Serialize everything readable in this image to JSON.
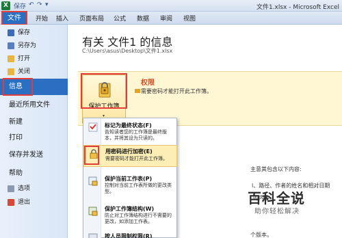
{
  "window": {
    "title": "文件1.xlsx - Microsoft Excel"
  },
  "quick_access": {
    "save": "保存",
    "undo": "↶",
    "redo": "↷",
    "more": "▾"
  },
  "ribbon": {
    "tabs": [
      "文件",
      "开始",
      "插入",
      "页面布局",
      "公式",
      "数据",
      "审阅",
      "视图"
    ],
    "active_tab": "文件"
  },
  "sidebar": {
    "items": [
      {
        "label": "保存",
        "icon": "save-icon"
      },
      {
        "label": "另存为",
        "icon": "save-as-icon"
      },
      {
        "label": "打开",
        "icon": "open-folder-icon"
      },
      {
        "label": "关闭",
        "icon": "close-file-icon"
      },
      {
        "label": "信息"
      },
      {
        "label": "最近所用文件"
      },
      {
        "label": "新建"
      },
      {
        "label": "打印"
      },
      {
        "label": "保存并发送"
      },
      {
        "label": "帮助"
      },
      {
        "label": "选项",
        "icon": "options-icon"
      },
      {
        "label": "退出",
        "icon": "exit-icon"
      }
    ],
    "active_item": "信息"
  },
  "info": {
    "title": "有关 文件1 的信息",
    "path": "C:\\Users\\asus\\Desktop\\文件1.xlsx",
    "permissions": {
      "button_label": "保护工作簿",
      "dropdown_arrow": "▾",
      "title": "权限",
      "description": "需要密码才能打开此工作簿。"
    },
    "background_text": {
      "check": "主意其包含以下内容:",
      "props": "l、路径、作者的姓名和相对日期",
      "content": "的内容",
      "version": "个版本。"
    }
  },
  "protect_menu": {
    "items": [
      {
        "title": "标记为最终状态(F)",
        "desc": "告知读者您的工作簿是最终版本，并将其设为只读的。",
        "icon": "mark-final-icon"
      },
      {
        "title": "用密码进行加密(E)",
        "desc": "需要密码才能打开此工作簿。",
        "icon": "encrypt-lock-icon"
      },
      {
        "title": "保护当前工作表(P)",
        "desc": "控制对当前工作表所做的更改类型。",
        "icon": "protect-sheet-icon"
      },
      {
        "title": "保护工作簿结构(W)",
        "desc": "防止对工作簿结构进行不需要的更改，如添加工作表。",
        "icon": "protect-structure-icon"
      },
      {
        "title": "按人员限制权限(R)",
        "desc": "",
        "icon": "restrict-icon"
      }
    ],
    "highlighted": 1
  },
  "watermark": {
    "big": "百科全说",
    "small": "助你轻松解决"
  },
  "colors": {
    "file_blue": "#2b6fc2",
    "highlight_red": "#e43b3b",
    "permission_band": "#fff7d4",
    "permission_title": "#c8512a"
  }
}
